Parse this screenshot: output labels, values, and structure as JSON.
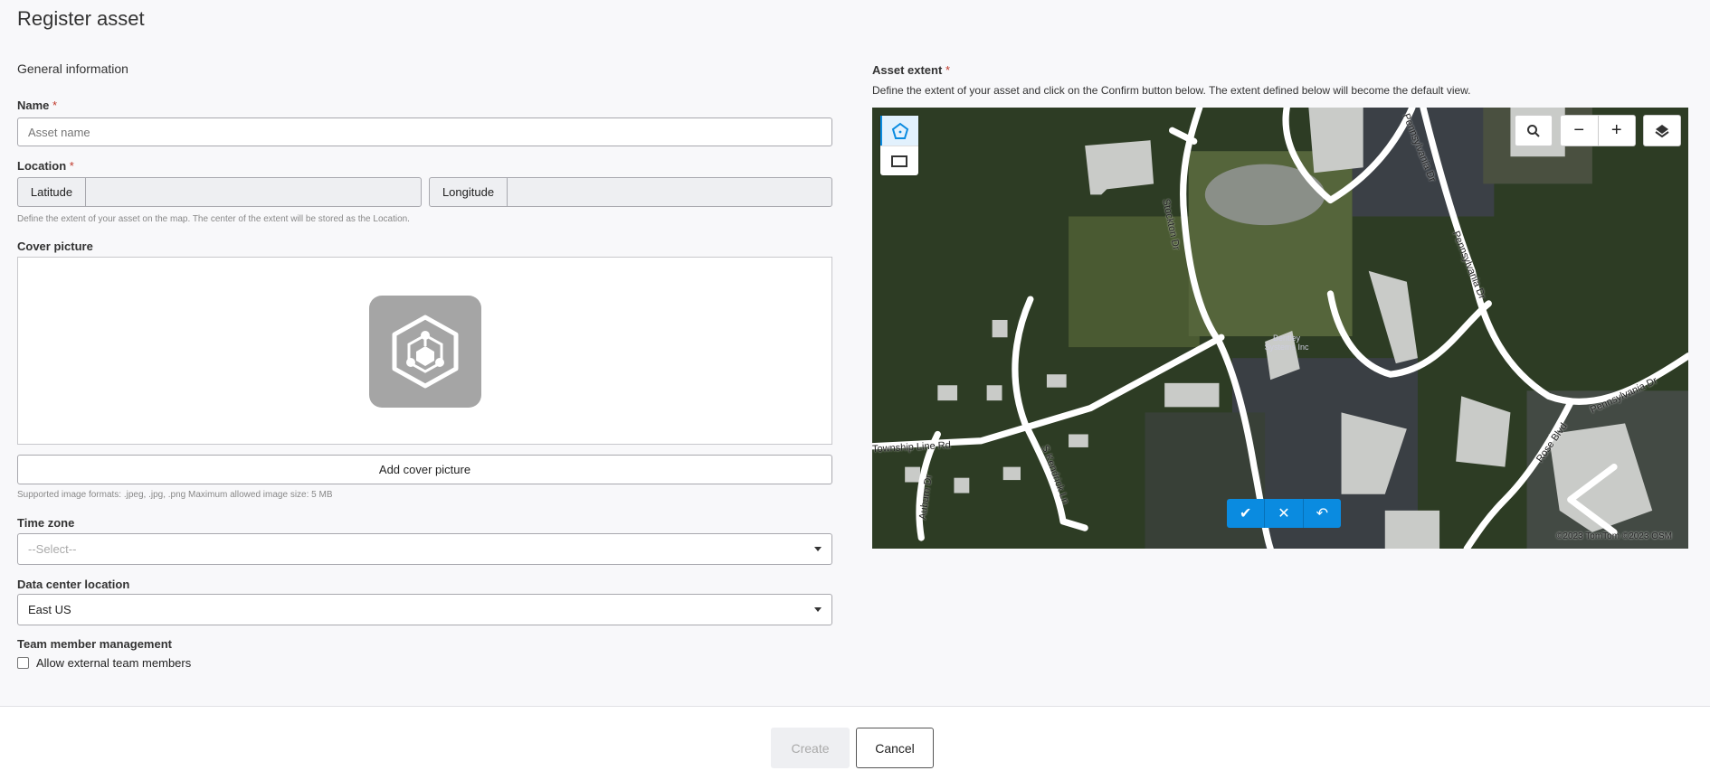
{
  "page_title": "Register asset",
  "general_section": "General information",
  "name": {
    "label": "Name",
    "required": "*",
    "placeholder": "Asset name",
    "value": ""
  },
  "location": {
    "label": "Location",
    "required": "*",
    "latitude_label": "Latitude",
    "longitude_label": "Longitude",
    "latitude_value": "",
    "longitude_value": "",
    "help": "Define the extent of your asset on the map. The center of the extent will be stored as the Location."
  },
  "cover": {
    "label": "Cover picture",
    "add_button": "Add cover picture",
    "help": "Supported image formats: .jpeg, .jpg, .png Maximum allowed image size: 5 MB"
  },
  "time_zone": {
    "label": "Time zone",
    "value": "--Select--"
  },
  "data_center": {
    "label": "Data center location",
    "value": "East US"
  },
  "team": {
    "label": "Team member management",
    "checkbox_label": "Allow external team members",
    "checked": false
  },
  "extent": {
    "label": "Asset extent",
    "required": "*",
    "description": "Define the extent of your asset and click on the Confirm button below. The extent defined below will become the default view."
  },
  "map": {
    "tools": [
      "polygon-icon",
      "rectangle-icon"
    ],
    "controls": {
      "search": "search-icon",
      "zoom_out": "−",
      "zoom_in": "+",
      "layers": "layers-icon"
    },
    "confirm_bar": {
      "confirm": "✔",
      "cancel": "✕",
      "undo": "↶"
    },
    "road_labels": [
      "Stockton Dr",
      "Pennsylvania Dr",
      "Pennsylvania Dr",
      "Pennsylvania Dr",
      "Township Line Rd",
      "S Kendrick Ln",
      "Auburn Dr",
      "Rose Blvd"
    ],
    "poi_label": "Bentley Systems Inc",
    "attribution": "©2023 TomTom ©2023 OSM",
    "accent_color": "#0a8be0"
  },
  "footer": {
    "create": "Create",
    "cancel": "Cancel"
  }
}
